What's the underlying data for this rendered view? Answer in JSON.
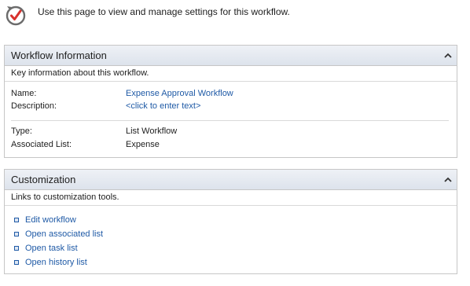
{
  "header": {
    "icon": "workflow-settings-icon",
    "text": "Use this page to view and manage settings for this workflow."
  },
  "workflow_info": {
    "title": "Workflow Information",
    "description": "Key information about this workflow.",
    "fields": {
      "name_label": "Name:",
      "name_value": "Expense Approval Workflow",
      "description_label": "Description:",
      "description_value": "<click to enter text>",
      "type_label": "Type:",
      "type_value": "List Workflow",
      "list_label": "Associated List:",
      "list_value": "Expense"
    }
  },
  "customization": {
    "title": "Customization",
    "description": "Links to customization tools.",
    "links": [
      "Edit workflow",
      "Open associated list",
      "Open task list",
      "Open history list"
    ]
  },
  "colors": {
    "link": "#1f5aa6",
    "icon_check": "#d8322d",
    "panel_border": "#c6c6c6"
  }
}
